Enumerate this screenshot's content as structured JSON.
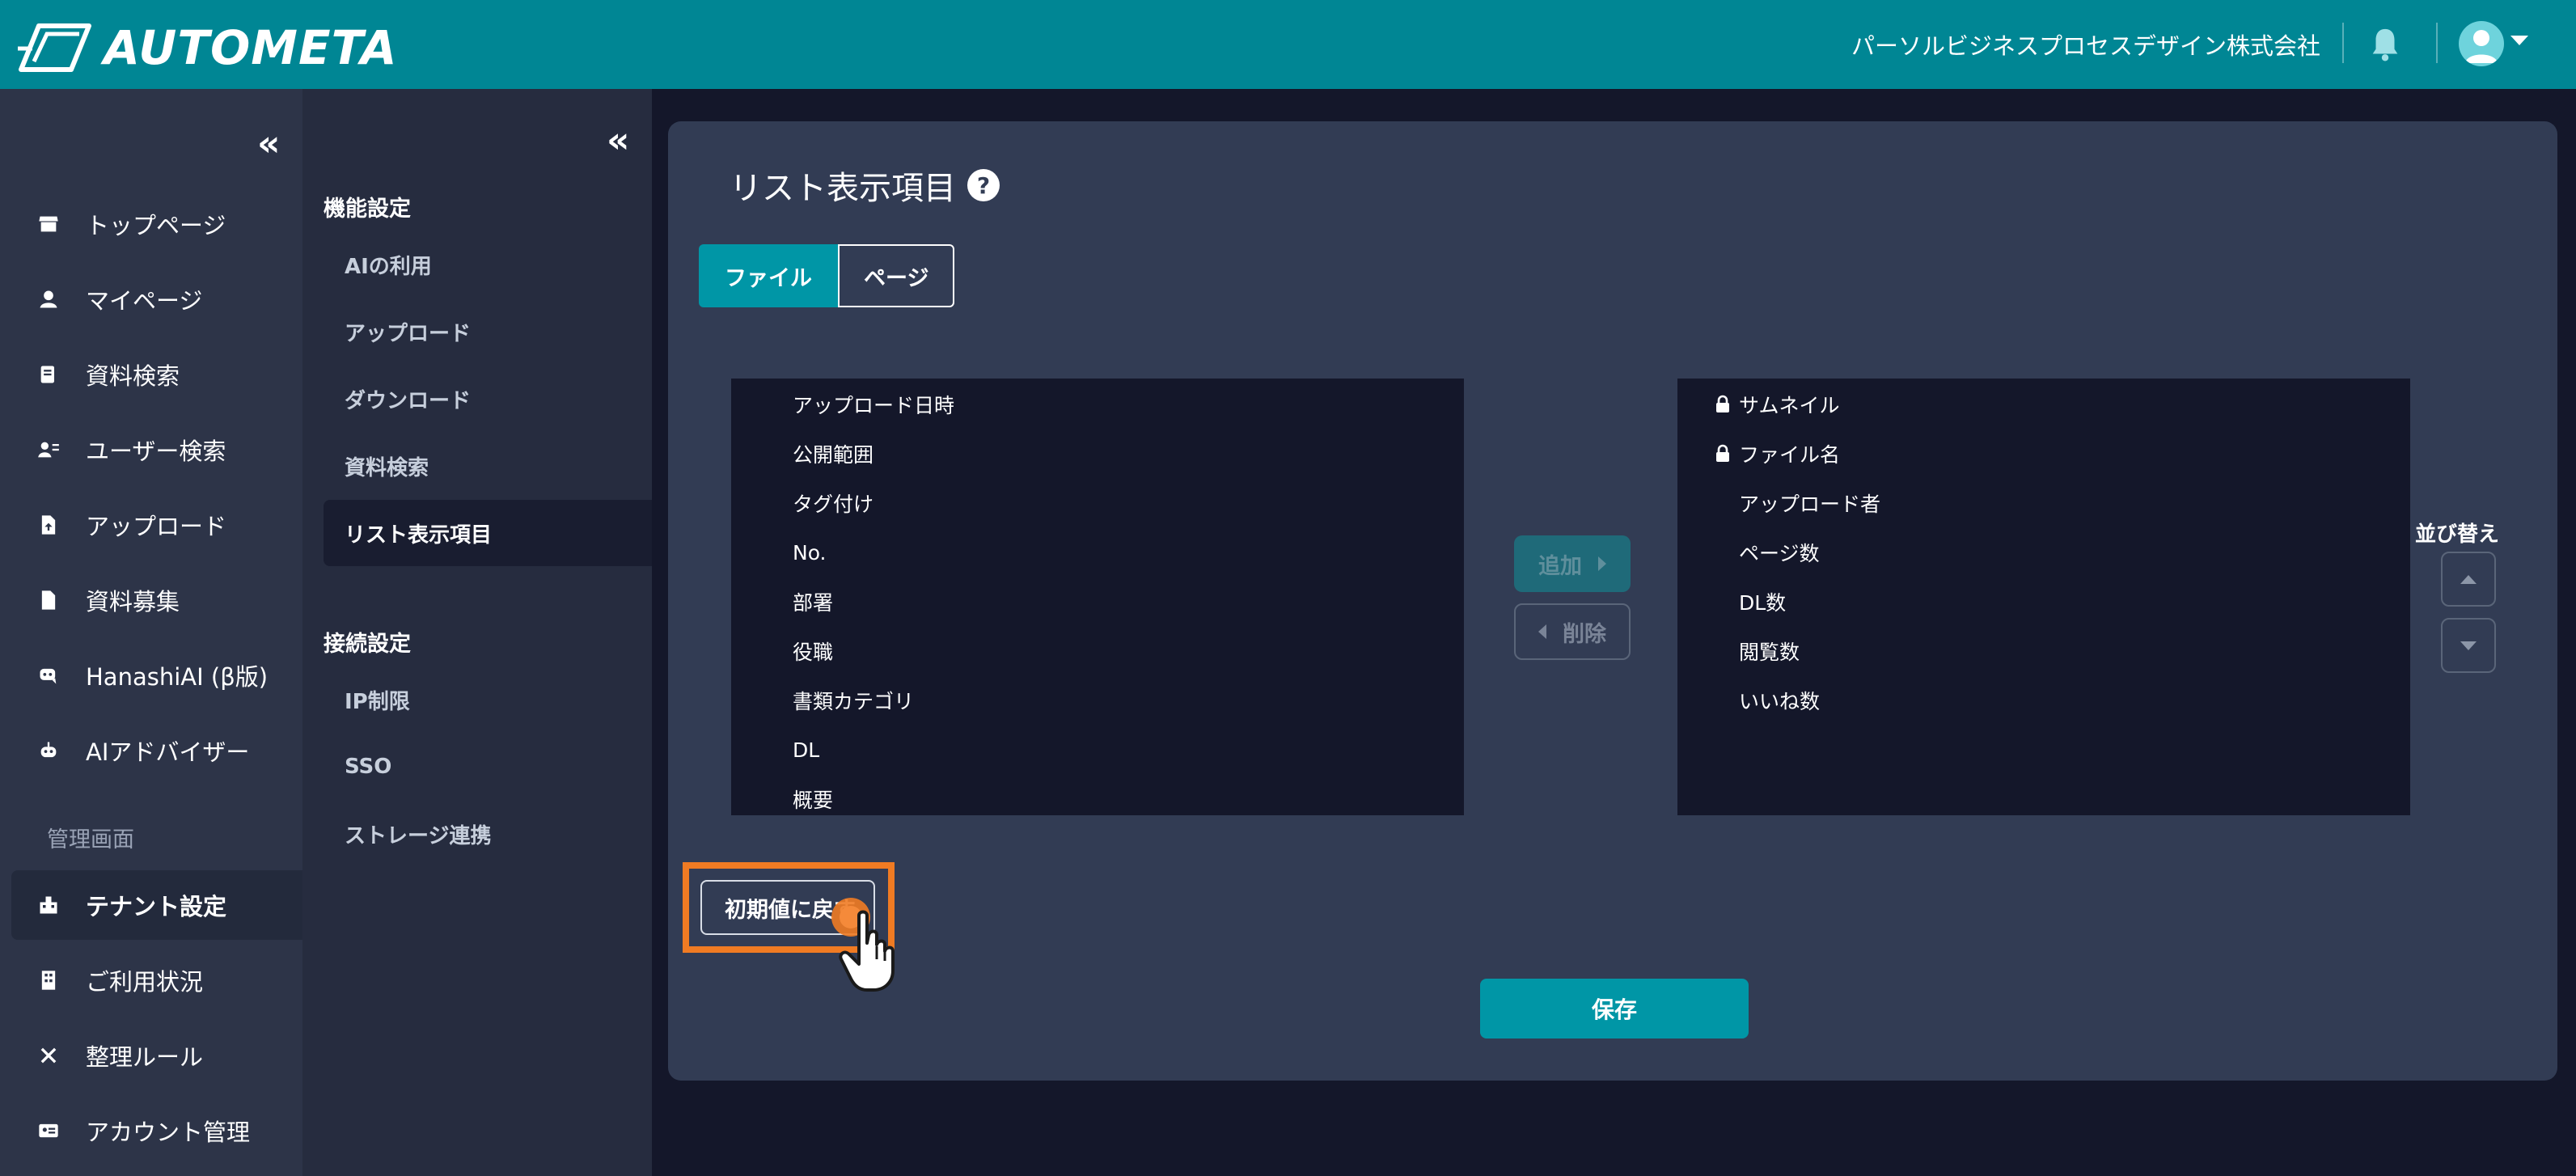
{
  "header": {
    "logo_text": "AUTOMETA",
    "company": "パーソルビジネスプロセスデザイン株式会社",
    "icons": [
      "logo-mark-icon",
      "bell-icon",
      "user-avatar-icon",
      "caret-down-icon"
    ]
  },
  "sidebar": {
    "collapse_label": "«",
    "items": [
      {
        "label": "トップページ",
        "icon": "store-icon"
      },
      {
        "label": "マイページ",
        "icon": "person-icon"
      },
      {
        "label": "資料検索",
        "icon": "document-search-icon"
      },
      {
        "label": "ユーザー検索",
        "icon": "user-search-icon"
      },
      {
        "label": "アップロード",
        "icon": "file-upload-icon"
      },
      {
        "label": "資料募集",
        "icon": "file-icon"
      },
      {
        "label": "HanashiAI (β版)",
        "icon": "chat-bot-icon"
      },
      {
        "label": "AIアドバイザー",
        "icon": "robot-icon"
      }
    ],
    "section_admin": "管理画面",
    "admin_items": [
      {
        "label": "テナント設定",
        "icon": "tenant-icon",
        "active": true
      },
      {
        "label": "ご利用状況",
        "icon": "building-icon"
      },
      {
        "label": "整理ルール",
        "icon": "tools-icon"
      },
      {
        "label": "アカウント管理",
        "icon": "id-card-icon"
      }
    ]
  },
  "subnav": {
    "collapse_label": "«",
    "section_function": "機能設定",
    "function_items": [
      "AIの利用",
      "アップロード",
      "ダウンロード",
      "資料検索",
      "リスト表示項目"
    ],
    "active_item": "リスト表示項目",
    "section_connection": "接続設定",
    "connection_items": [
      "IP制限",
      "SSO",
      "ストレージ連携"
    ]
  },
  "main": {
    "title": "リスト表示項目",
    "help_label": "?",
    "tabs": [
      {
        "label": "ファイル",
        "active": true
      },
      {
        "label": "ページ",
        "active": false
      }
    ],
    "available_items": [
      "アップロード日時",
      "公開範囲",
      "タグ付け",
      "No.",
      "部署",
      "役職",
      "書類カテゴリ",
      "DL",
      "概要"
    ],
    "selected_items": [
      {
        "label": "サムネイル",
        "locked": true
      },
      {
        "label": "ファイル名",
        "locked": true
      },
      {
        "label": "アップロード者",
        "locked": false
      },
      {
        "label": "ページ数",
        "locked": false
      },
      {
        "label": "DL数",
        "locked": false
      },
      {
        "label": "閲覧数",
        "locked": false
      },
      {
        "label": "いいね数",
        "locked": false
      }
    ],
    "add_label": "追加",
    "delete_label": "削除",
    "sort_label": "並び替え",
    "reset_label": "初期値に戻す",
    "save_label": "保存"
  },
  "colors": {
    "header": "#008694",
    "accent": "#0096a6",
    "highlight": "#f07b23",
    "sidebar": "#2d3448",
    "panel": "#323c54"
  }
}
